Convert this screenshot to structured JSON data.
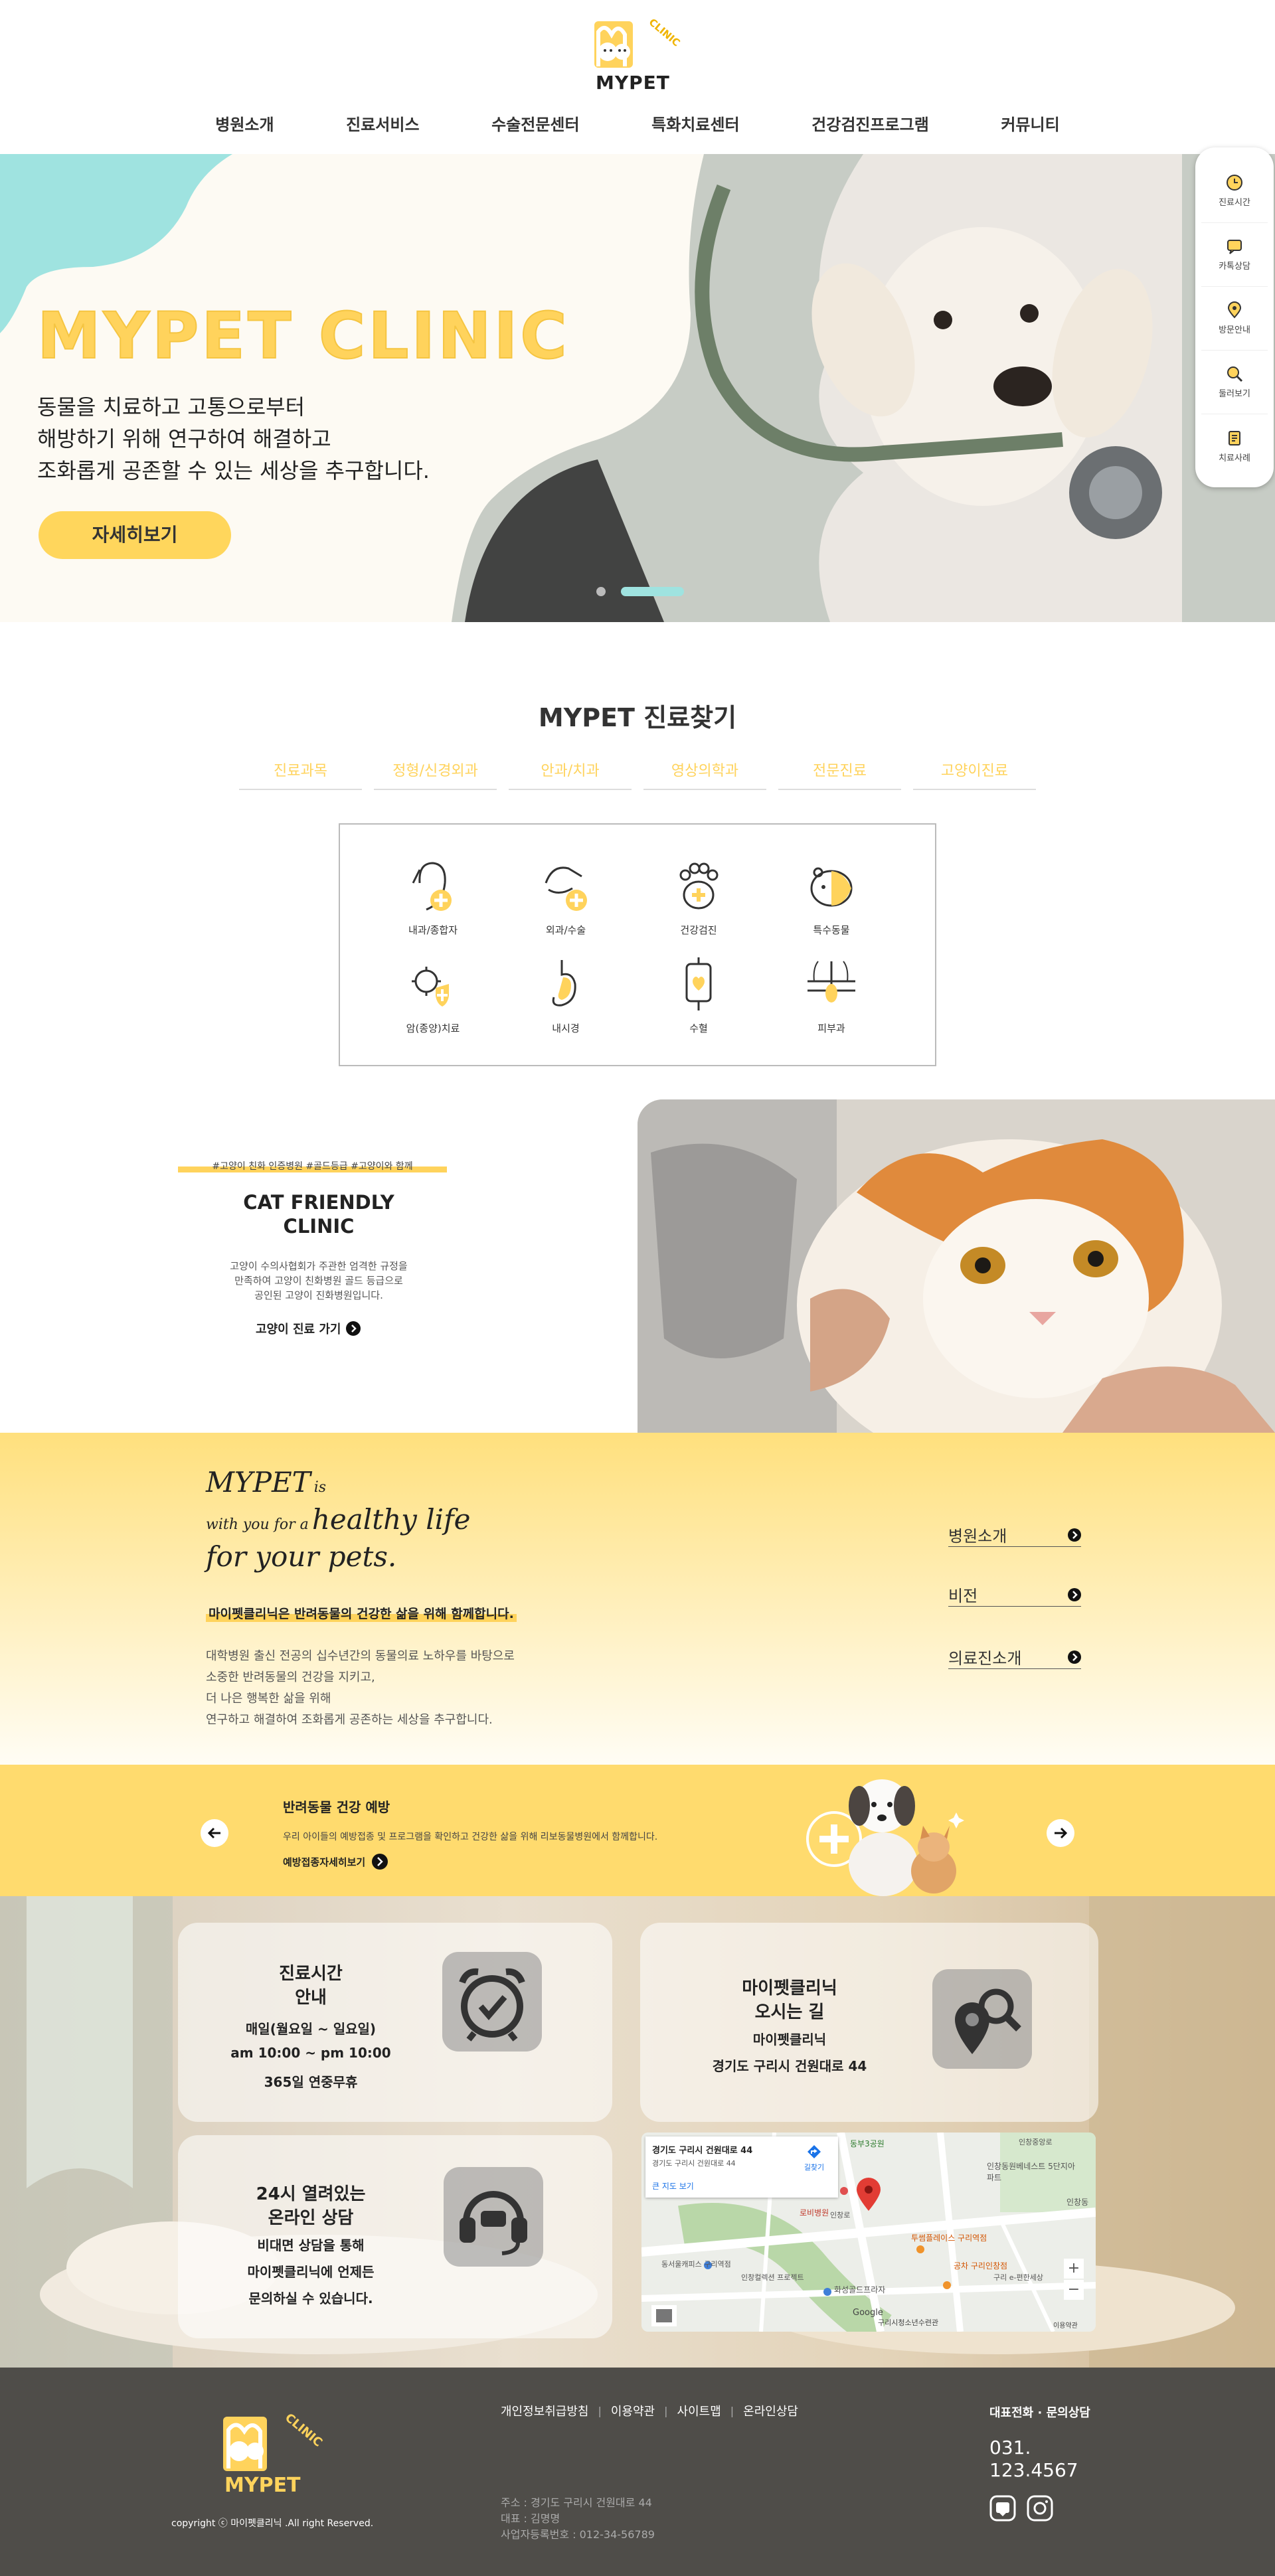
{
  "header": {
    "logo_text": "MYPET",
    "logo_badge": "CLINIC",
    "nav": [
      "병원소개",
      "진료서비스",
      "수술전문센터",
      "특화치료센터",
      "건강검진프로그램",
      "커뮤니티"
    ]
  },
  "hero": {
    "title": "MYPET CLINIC",
    "lines": [
      "동물을 치료하고 고통으로부터",
      "해방하기 위해 연구하여 해결하고",
      "조화롭게 공존할 수 있는 세상을 추구합니다."
    ],
    "button": "자세히보기"
  },
  "quick_menu": [
    {
      "label": "진료시간",
      "icon": "clock-icon"
    },
    {
      "label": "카톡상담",
      "icon": "chat-icon"
    },
    {
      "label": "방문안내",
      "icon": "location-pin-icon"
    },
    {
      "label": "둘러보기",
      "icon": "search-icon"
    },
    {
      "label": "치료사례",
      "icon": "note-icon"
    }
  ],
  "find": {
    "title": "MYPET 진료찾기",
    "tabs": [
      "진료과목",
      "정형/신경외과",
      "안과/치과",
      "영상의학과",
      "전문진료",
      "고양이진료"
    ],
    "services": [
      {
        "label": "내과/종합자",
        "icon": "dog-medical-icon"
      },
      {
        "label": "외과/수술",
        "icon": "dog-surgery-icon"
      },
      {
        "label": "건강검진",
        "icon": "paw-cross-icon"
      },
      {
        "label": "특수동물",
        "icon": "hamster-icon"
      },
      {
        "label": "암(종양)치료",
        "icon": "virus-shield-icon"
      },
      {
        "label": "내시경",
        "icon": "stomach-icon"
      },
      {
        "label": "수혈",
        "icon": "blood-bag-icon"
      },
      {
        "label": "피부과",
        "icon": "skin-hair-icon"
      }
    ]
  },
  "cat": {
    "tags": "#고양이 친화 인증병원 #골드등급 #고양이와 함께",
    "title_line1": "CAT FRIENDLY",
    "title_line2": "CLINIC",
    "desc": [
      "고양이 수의사협회가 주관한 엄격한 규정을",
      "만족하여 고양이 친화병원 골드 등급으로",
      "공인된 고양이 진화병원입니다."
    ],
    "link": "고양이 진료 가기"
  },
  "about": {
    "brand": "MYPET",
    "is": "is",
    "line2_small": "with you for a",
    "line2_big": "healthy life",
    "line3": "for your pets.",
    "highlight": "마이펫클리닉은 반려동물의 건강한 삶을 위해 함께합니다.",
    "desc": [
      "대학병원 출신 전공의 십수년간의 동물의료 노하우를 바탕으로",
      "소중한 반려동물의 건강을 지키고,",
      "더 나은 행복한 삶을 위해",
      "연구하고 해결하여 조화롭게 공존하는 세상을 추구합니다."
    ],
    "links": [
      "병원소개",
      "비전",
      "의료진소개"
    ]
  },
  "prevention": {
    "title": "반려동물 건강 예방",
    "desc": "우리 아이들의 예방접종 및 프로그램을 확인하고 건강한 삶을 위해 리보동물병원에서 함께합니다.",
    "link": "예방접종자세히보기"
  },
  "info": {
    "hours": {
      "title1": "진료시간",
      "title2": "안내",
      "lines": [
        "매일(월요일 ~ 일요일)",
        "am 10:00 ~ pm 10:00",
        "365일 연중무휴"
      ]
    },
    "directions": {
      "title1": "마이펫클리닉",
      "title2": "오시는 길",
      "lines": [
        "마이펫클리닉",
        "경기도 구리시 건원대로 44"
      ]
    },
    "consult": {
      "title1": "24시 열려있는",
      "title2": "온라인 상담",
      "lines": [
        "비대면 상담을 통해",
        "마이펫클리닉에 언제든",
        "문의하실 수 있습니다."
      ]
    },
    "map": {
      "address": "경기도 구리시 건원대로 44",
      "address_sub": "경기도 구리시 건원대로 44",
      "directions": "길찾기",
      "bigger": "큰 지도 보기",
      "labels": [
        "동부3공원",
        "인창중앙로",
        "인창동원베네스트 5단지아파트",
        "인창동",
        "로비병원",
        "인창로",
        "동서울캐피스 구리역점",
        "투썸플레이스 구리역점",
        "화성골드프라자",
        "공차 구리인창점",
        "인창컬렉션 프로젝트",
        "구리 e-편한세상",
        "Google",
        "구리시청소년수련관",
        "이용약관"
      ],
      "zoom_in": "+",
      "zoom_out": "−"
    }
  },
  "footer": {
    "links": [
      "개인정보취급방침",
      "이용약관",
      "사이트맵",
      "온라인상담"
    ],
    "address": "주소 : 경기도 구리시 건원대로 44",
    "ceo": "대표 : 김명명",
    "biz": "사업자등록번호 : 012-34-56789",
    "copyright": "copyright ⓒ 마이펫클리닉 .All right Reserved.",
    "contact_title": "대표전화 · 문의상담",
    "phone_line1": "031.",
    "phone_line2": "123.4567"
  },
  "colors": {
    "accent": "#ffd35c",
    "mint": "#9fe3e0",
    "footer": "#4f4d49"
  }
}
